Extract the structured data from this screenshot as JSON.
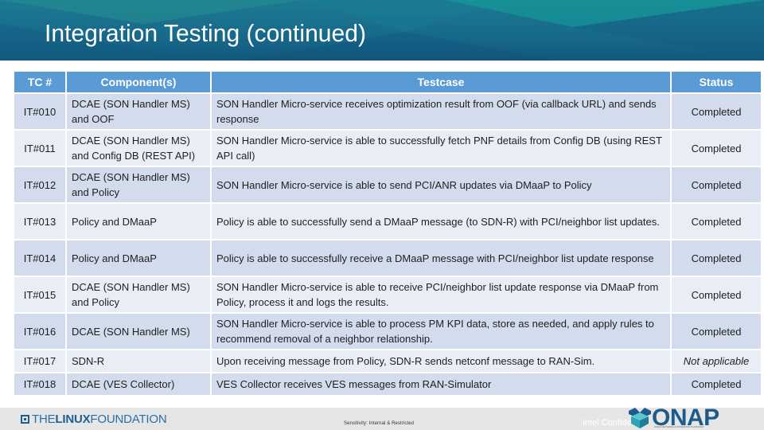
{
  "slide": {
    "title": "Integration Testing (continued)"
  },
  "table": {
    "headers": [
      "TC #",
      "Component(s)",
      "Testcase",
      "Status"
    ],
    "rows": [
      {
        "tc": "IT#010",
        "component": "DCAE (SON Handler MS) and OOF",
        "testcase": "SON Handler Micro-service receives optimization result from OOF (via callback URL) and sends response",
        "status": "Completed"
      },
      {
        "tc": "IT#011",
        "component": "DCAE (SON Handler MS) and Config DB (REST API)",
        "testcase": "SON Handler Micro-service is able to successfully fetch PNF details from Config DB (using REST API call)",
        "status": "Completed"
      },
      {
        "tc": "IT#012",
        "component": "DCAE (SON Handler MS) and Policy",
        "testcase": "SON Handler Micro-service is able to send PCI/ANR updates via DMaaP to Policy",
        "status": "Completed"
      },
      {
        "tc": "IT#013",
        "component": "Policy and DMaaP",
        "testcase": "Policy is able to successfully send a DMaaP message (to SDN-R) with PCI/neighbor list updates.",
        "status": "Completed"
      },
      {
        "tc": "IT#014",
        "component": "Policy and DMaaP",
        "testcase": "Policy is able to successfully receive a DMaaP message with PCI/neighbor list update response",
        "status": "Completed"
      },
      {
        "tc": "IT#015",
        "component": "DCAE (SON Handler MS) and Policy",
        "testcase": "SON Handler Micro-service is able to receive PCI/neighbor list update response via DMaaP from Policy, process it and logs the results.",
        "status": "Completed"
      },
      {
        "tc": "IT#016",
        "component": "DCAE (SON Handler MS)",
        "testcase": "SON Handler Micro-service is able to process PM KPI data, store as needed, and apply rules to recommend removal of a neighbor relationship.",
        "status": "Completed"
      },
      {
        "tc": "IT#017",
        "component": "SDN-R",
        "testcase": "Upon receiving message from Policy, SDN-R sends netconf message to RAN-Sim.",
        "status": "Not applicable"
      },
      {
        "tc": "IT#018",
        "component": "DCAE (VES Collector)",
        "testcase": "VES Collector receives VES messages from RAN-Simulator",
        "status": "Completed"
      }
    ]
  },
  "footer": {
    "linux_foundation_the": "THE",
    "linux_foundation_linux": "LINUX",
    "linux_foundation_foundation": "FOUNDATION",
    "sensitivity": "Sensitivity: Internal & Restricted",
    "intel": "Intel Confidential",
    "onap": "ONAP",
    "onap_tagline": "OPEN NETWORK AUTOMATION PLATFORM"
  },
  "colors": {
    "banner": "#17698a",
    "header": "#5b9bd5",
    "row_odd": "#d2dcec",
    "row_even": "#e9eef6"
  }
}
